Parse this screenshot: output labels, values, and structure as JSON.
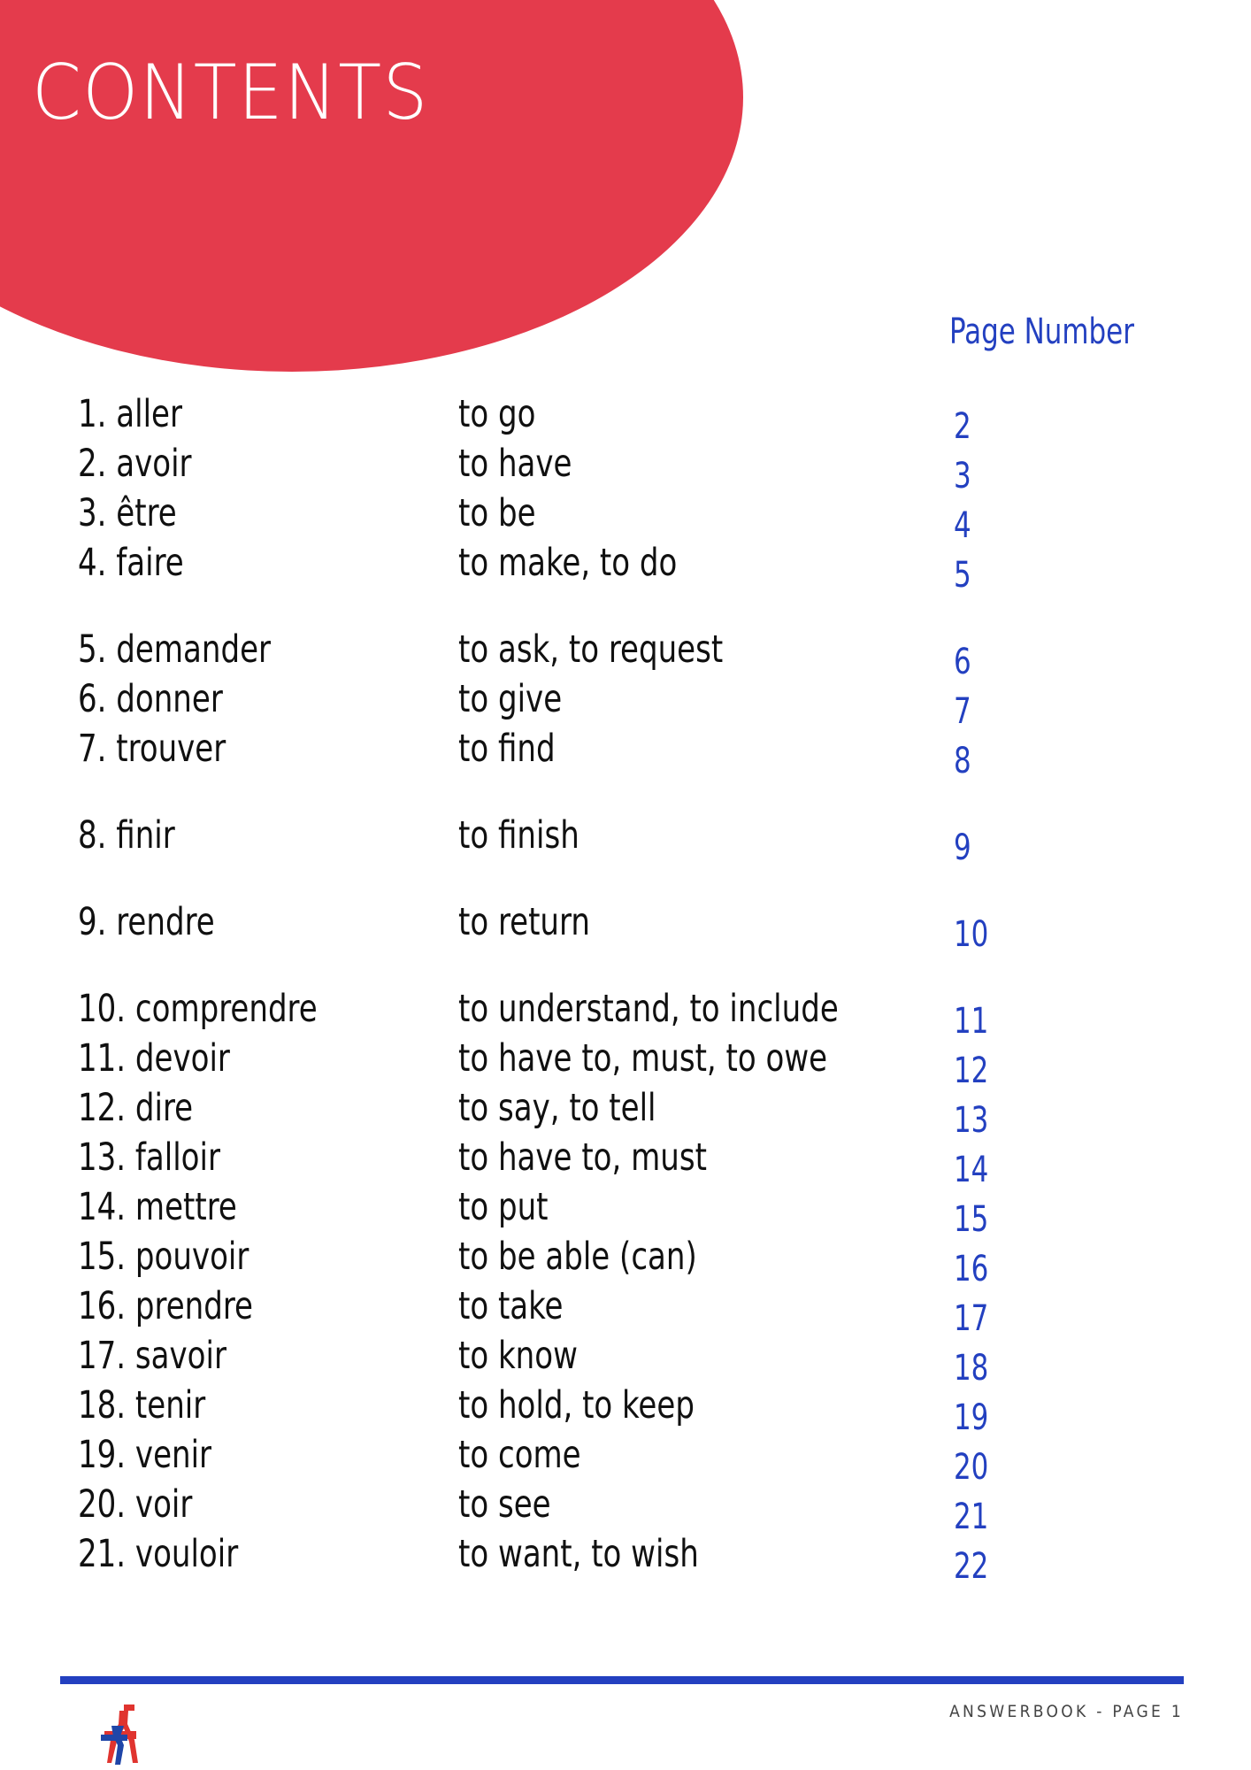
{
  "header": {
    "title": "CONTENTS",
    "blob_color": "#E43B4C"
  },
  "columns": {
    "page_number_heading": "Page Number"
  },
  "colors": {
    "red": "#E43B4C",
    "blue": "#2340C0",
    "text": "#101010",
    "footer_text": "#444444"
  },
  "groups": [
    {
      "rows": [
        {
          "french": "1. aller",
          "english": "to go",
          "page": "2"
        },
        {
          "french": "2. avoir",
          "english": "to have",
          "page": "3"
        },
        {
          "french": "3. être",
          "english": "to be",
          "page": "4"
        },
        {
          "french": "4. faire",
          "english": "to make, to do",
          "page": "5"
        }
      ]
    },
    {
      "rows": [
        {
          "french": "5. demander",
          "english": "to ask, to request",
          "page": "6"
        },
        {
          "french": "6. donner",
          "english": "to give",
          "page": "7"
        },
        {
          "french": "7. trouver",
          "english": "to find",
          "page": "8"
        }
      ]
    },
    {
      "rows": [
        {
          "french": "8. finir",
          "english": "to finish",
          "page": "9"
        }
      ]
    },
    {
      "rows": [
        {
          "french": "9. rendre",
          "english": "to return",
          "page": "10"
        }
      ]
    },
    {
      "rows": [
        {
          "french": "10. comprendre",
          "english": "to understand, to include",
          "page": "11"
        },
        {
          "french": "11. devoir",
          "english": "to have to, must, to owe",
          "page": "12"
        },
        {
          "french": "12. dire",
          "english": "to say, to tell",
          "page": "13"
        },
        {
          "french": "13. falloir",
          "english": "to have to, must",
          "page": "14"
        },
        {
          "french": "14. mettre",
          "english": "to put",
          "page": "15"
        },
        {
          "french": "15. pouvoir",
          "english": "to be able (can)",
          "page": "16"
        },
        {
          "french": "16. prendre",
          "english": "to take",
          "page": "17"
        },
        {
          "french": "17. savoir",
          "english": "to know",
          "page": "18"
        },
        {
          "french": "18. tenir",
          "english": "to hold, to keep",
          "page": "19"
        },
        {
          "french": "19. venir",
          "english": "to come",
          "page": "20"
        },
        {
          "french": "20. voir",
          "english": "to see",
          "page": "21"
        },
        {
          "french": "21. vouloir",
          "english": "to want, to wish",
          "page": "22"
        }
      ]
    }
  ],
  "footer": {
    "label": "ANSWERBOOK - PAGE 1",
    "logo_name": "eiffel-tower-logo"
  }
}
